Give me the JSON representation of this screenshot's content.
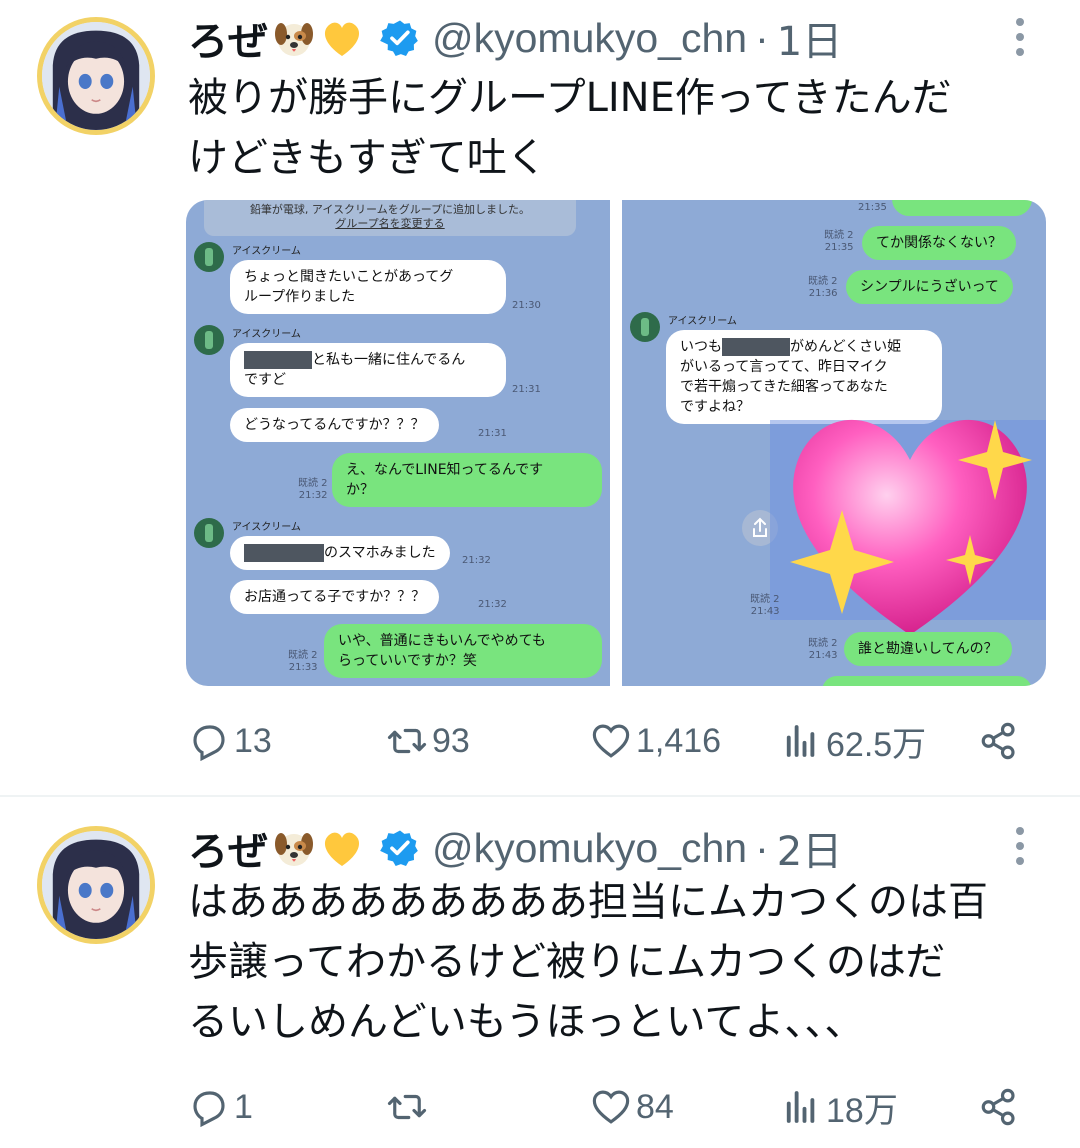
{
  "tweets": [
    {
      "name": "ろぜ",
      "handle": "@kyomukyo_chn",
      "separator": "·",
      "time": "1日",
      "text": "被りが勝手にグループLINE作ってきたんだ\nけどきもすぎて吐く",
      "stats": {
        "replies": "13",
        "retweets": "93",
        "likes": "1,416",
        "views": "62.5万"
      }
    },
    {
      "name": "ろぜ",
      "handle": "@kyomukyo_chn",
      "separator": "·",
      "time": "2日",
      "text": "はあああああああああ担当にムカつくのは百\n歩譲ってわかるけど被りにムカつくのはだ\nるいしめんどいもうほっといてよ、、、",
      "stats": {
        "replies": "1",
        "retweets": "",
        "likes": "84",
        "views": "18万"
      }
    }
  ],
  "screenshot_left": {
    "system_line1": "鉛筆が電球, アイスクリームをグループに追加しました。",
    "system_link": "グループ名を変更する",
    "sender": "アイスクリーム",
    "msg1": "ちょっと聞きたいことがあってグ\nループ作りました",
    "msg1_time": "21:30",
    "msg2_suffix": "と私も一緒に住んでるん\nですど",
    "msg2_time": "21:31",
    "msg3": "どうなってるんですか？？？",
    "msg3_time": "21:31",
    "msg4": "え、なんでLINE知ってるんです\nか？",
    "msg4_meta": "既読 2\n21:32",
    "msg5_suffix": "のスマホみました",
    "msg5_time": "21:32",
    "msg6": "お店通ってる子ですか？？？",
    "msg6_time": "21:32",
    "msg7": "いや、普通にきもいんでやめても\nらっていいですか？笑",
    "msg7_meta": "既読 2\n21:33"
  },
  "screenshot_right": {
    "top_time": "21:35",
    "msg1": "てか関係なくない？",
    "msg1_meta": "既読 2\n21:35",
    "msg2": "シンプルにうざいって",
    "msg2_meta": "既読 2\n21:36",
    "sender": "アイスクリーム",
    "msg3_prefix": "いつも",
    "msg3_rest": "がめんどくさい姫\nがいるって言ってて、昨日マイク\nで若干煽ってきた細客ってあなた\nですよね？",
    "msg4_meta": "既読 2\n21:43",
    "msg5": "誰と勘違いしてんの？",
    "msg5_meta": "既読 2\n21:43"
  },
  "colors": {
    "verified": "#1d9bf0",
    "line_bg": "#8eaad6",
    "green_bubble": "#79e47e",
    "icon_gray": "#536471"
  },
  "icons": [
    "reply-icon",
    "retweet-icon",
    "like-icon",
    "views-icon",
    "share-icon",
    "verified-icon",
    "more-icon"
  ]
}
